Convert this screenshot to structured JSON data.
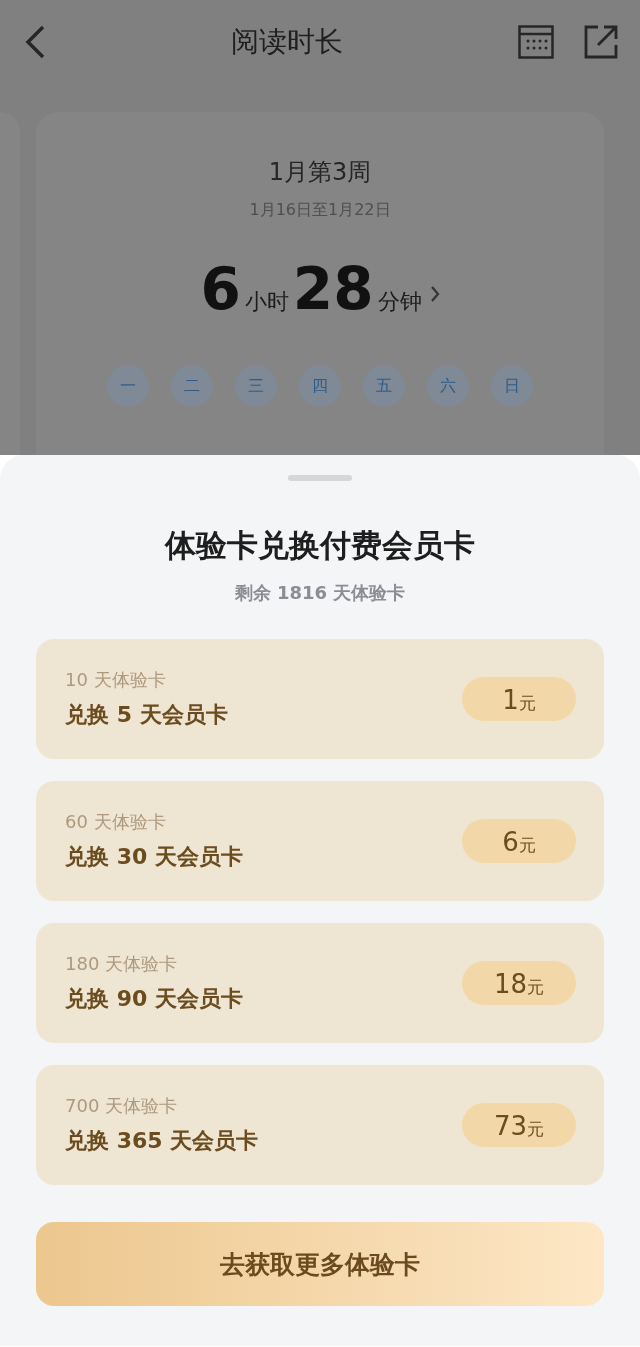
{
  "header": {
    "title": "阅读时长"
  },
  "week_card": {
    "title": "1月第3周",
    "range": "1月16日至1月22日",
    "hours": "6",
    "hours_unit": "小时",
    "minutes": "28",
    "minutes_unit": "分钟",
    "days": [
      "一",
      "二",
      "三",
      "四",
      "五",
      "六",
      "日"
    ]
  },
  "sheet": {
    "title": "体验卡兑换付费会员卡",
    "subtitle": "剩余 1816 天体验卡",
    "options": [
      {
        "cost": "10 天体验卡",
        "reward": "兑换 5 天会员卡",
        "price": "1",
        "unit": "元"
      },
      {
        "cost": "60 天体验卡",
        "reward": "兑换 30 天会员卡",
        "price": "6",
        "unit": "元"
      },
      {
        "cost": "180 天体验卡",
        "reward": "兑换 90 天会员卡",
        "price": "18",
        "unit": "元"
      },
      {
        "cost": "700 天体验卡",
        "reward": "兑换 365 天会员卡",
        "price": "73",
        "unit": "元"
      }
    ],
    "button": "去获取更多体验卡"
  }
}
